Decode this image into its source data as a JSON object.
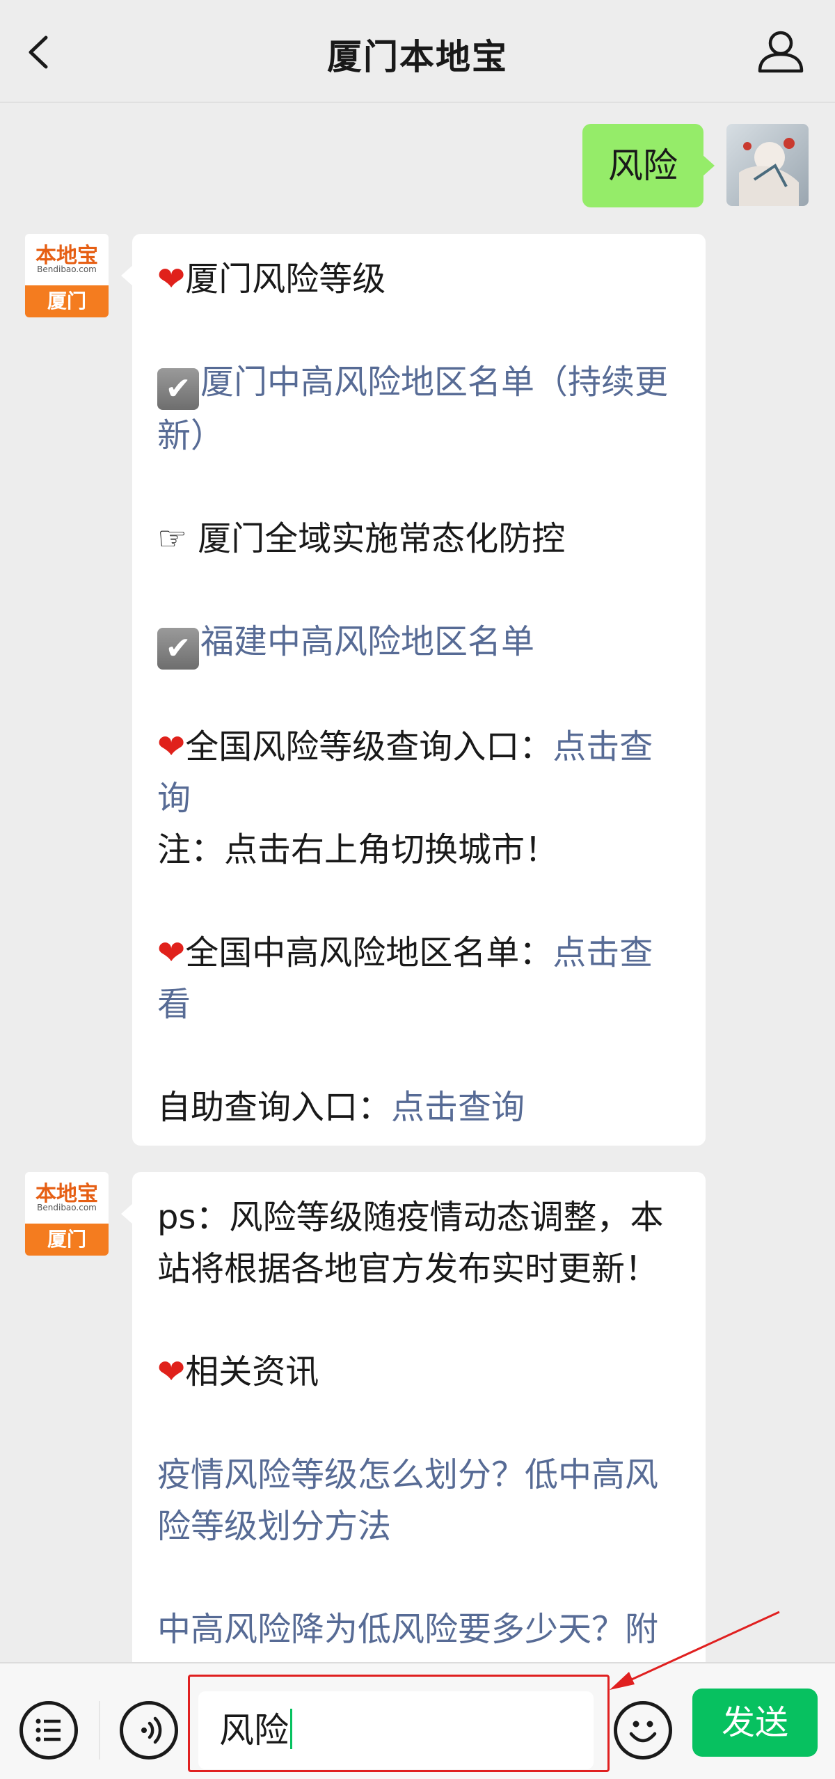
{
  "header": {
    "title": "厦门本地宝",
    "back_icon": "chevron-left-icon",
    "profile_icon": "person-icon"
  },
  "outgoing": {
    "text": "风险"
  },
  "bot": {
    "avatar_brand": "本地宝",
    "avatar_sub": "Bendibao.com",
    "avatar_city": "厦门"
  },
  "message1": {
    "l1": "厦门风险等级",
    "l2": "厦门中高风险地区名单（持续更新）",
    "l3_icon": "☞",
    "l3": "厦门全域实施常态化防控",
    "l4": "福建中高风险地区名单",
    "l5_text": "全国风险等级查询入口：",
    "l5_link": "点击查询",
    "l6": "注：点击右上角切换城市！",
    "l7_text": "全国中高风险地区名单：",
    "l7_link": "点击查看",
    "l8_text": "自助查询入口：",
    "l8_link": "点击查询"
  },
  "message2": {
    "l1": "ps：风险等级随疫情动态调整，本站将根据各地官方发布实时更新！",
    "l2": "相关资讯",
    "l3": "疫情风险等级怎么划分？低中高风险等级划分方法",
    "l4": "中高风险降为低风险要多少天？附"
  },
  "input": {
    "value": "风险"
  },
  "send_label": "发送",
  "colors": {
    "accent": "#07c160",
    "bubble_out": "#95ec69",
    "link": "#576b95",
    "annotation": "#e02020"
  }
}
